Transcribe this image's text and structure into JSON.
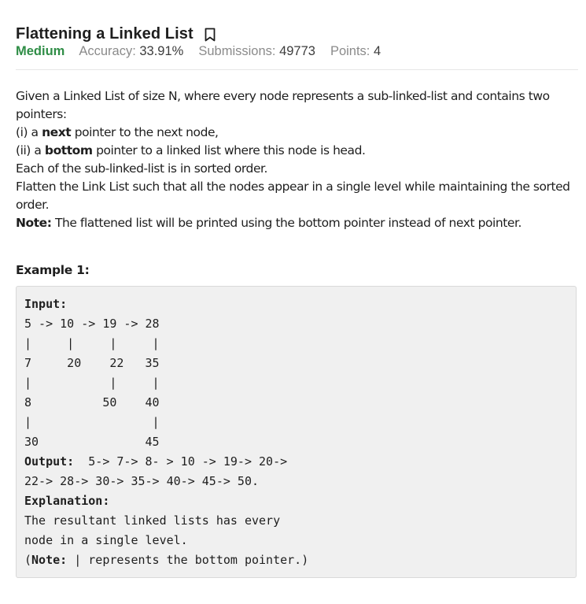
{
  "problem": {
    "title": "Flattening a Linked List",
    "difficulty": "Medium",
    "accuracy_label": "Accuracy:",
    "accuracy_value": "33.91%",
    "submissions_label": "Submissions:",
    "submissions_value": "49773",
    "points_label": "Points:",
    "points_value": "4",
    "bookmark_icon": "bookmark-icon"
  },
  "statement": {
    "line1": "Given a Linked List of size N, where every node represents a sub-linked-list and contains two pointers:",
    "line2_pre": "(i) a ",
    "line2_bold": "next",
    "line2_post": " pointer to the next node,",
    "line3_pre": "(ii) a ",
    "line3_bold": "bottom",
    "line3_post": " pointer to a linked list where this node is head.",
    "line4": "Each of the sub-linked-list is in sorted order.",
    "line5": "Flatten the Link List such that all the nodes appear in a single level while maintaining the sorted order.",
    "note_label": "Note:",
    "note_text": " The flattened list will be printed using the bottom pointer instead of next pointer."
  },
  "example": {
    "heading": "Example 1:",
    "input_label": "Input:",
    "diagram_lines": [
      "5 -> 10 -> 19 -> 28",
      "|     |     |     |",
      "7     20    22   35",
      "|           |     |",
      "8          50    40",
      "|                 |",
      "30               45"
    ],
    "output_label": "Output:",
    "output_line1": "  5-> 7-> 8- > 10 -> 19-> 20->",
    "output_line2": "22-> 28-> 30-> 35-> 40-> 45-> 50.",
    "explanation_label": "Explanation:",
    "explanation_line1": "The resultant linked lists has every",
    "explanation_line2": "node in a single level.",
    "note_open": "(",
    "note_label": "Note:",
    "note_text": " | represents the bottom pointer.)"
  }
}
